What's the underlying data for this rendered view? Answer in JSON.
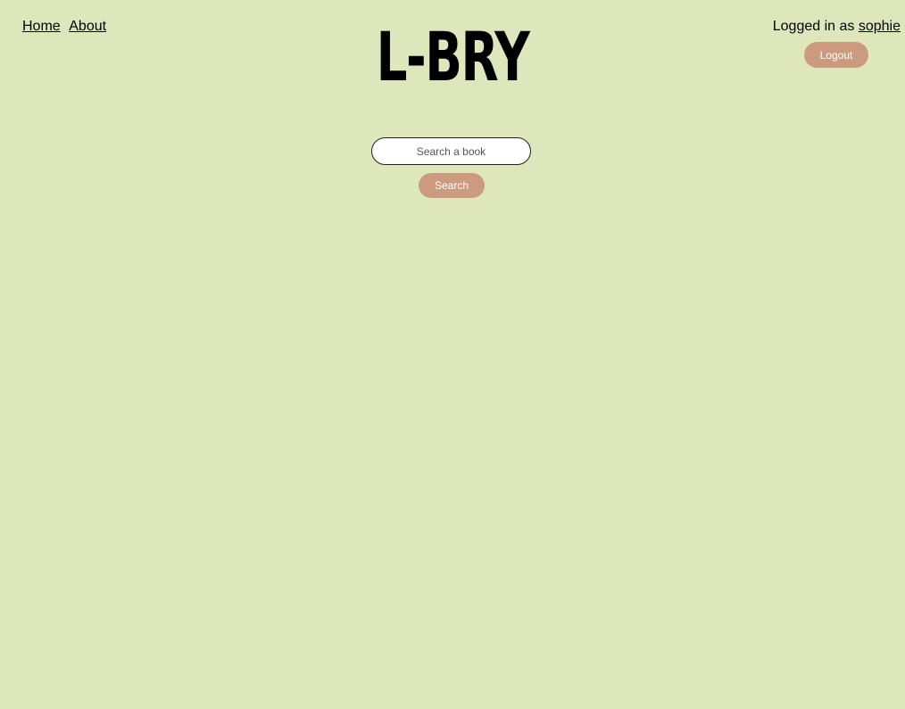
{
  "nav": {
    "home_label": "Home",
    "about_label": "About"
  },
  "logo": {
    "text": "L-BRY"
  },
  "user": {
    "logged_in_prefix": "Logged in as",
    "username": "sophie",
    "logout_label": "Logout"
  },
  "search": {
    "placeholder": "Search a book",
    "value": "",
    "button_label": "Search"
  },
  "colors": {
    "background": "#dee6bb",
    "button": "#cc9a7e",
    "button_text": "#ffffff",
    "text": "#000000"
  }
}
